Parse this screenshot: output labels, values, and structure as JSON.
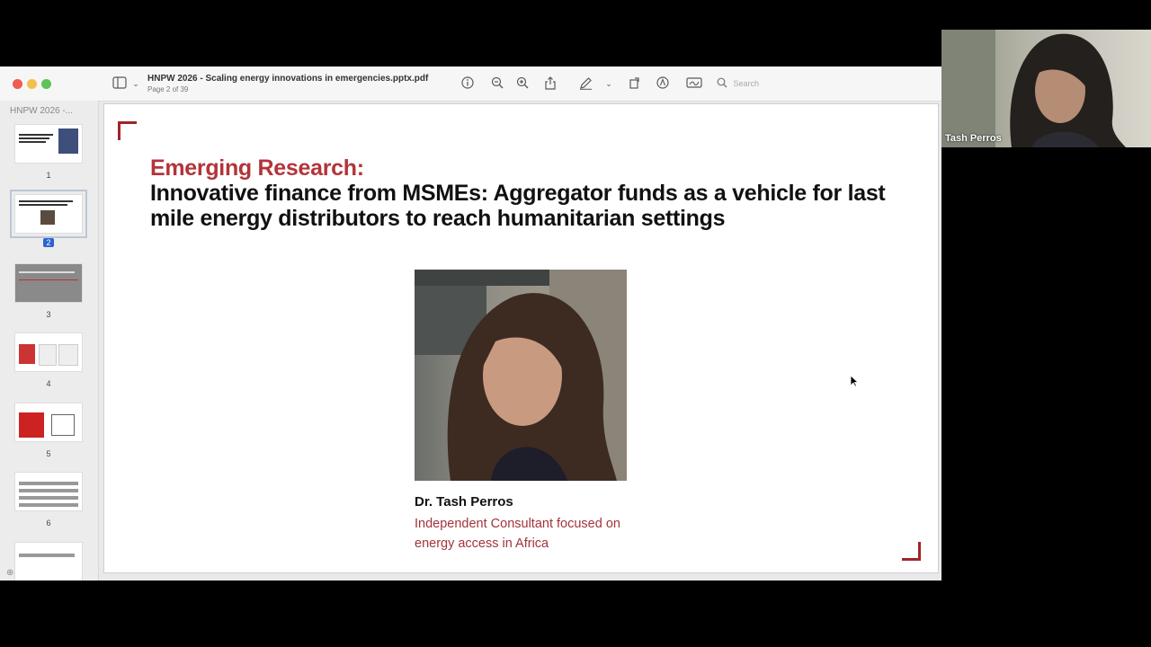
{
  "window": {
    "title": "HNPW 2026 - Scaling energy innovations in emergencies.pptx.pdf",
    "page_indicator": "Page 2 of 39",
    "search_placeholder": "Search"
  },
  "sidebar": {
    "title": "HNPW 2026 -...",
    "thumbnails": [
      {
        "label": "1",
        "selected": false
      },
      {
        "label": "2",
        "selected": true
      },
      {
        "label": "3",
        "selected": false
      },
      {
        "label": "4",
        "selected": false
      },
      {
        "label": "5",
        "selected": false
      },
      {
        "label": "6",
        "selected": false
      }
    ]
  },
  "slide": {
    "kicker": "Emerging Research:",
    "title": "Innovative finance from MSMEs: Aggregator funds as a vehicle for last mile energy distributors to reach humanitarian settings",
    "speaker_name": "Dr. Tash Perros",
    "speaker_role": "Independent Consultant focused on energy access in Africa",
    "accent_color": "#a3232a"
  },
  "webcam": {
    "participant_name": "Tash Perros"
  },
  "icons": [
    "sidebar-toggle-icon",
    "info-icon",
    "zoom-out-icon",
    "zoom-in-icon",
    "share-icon",
    "markup-pen-icon",
    "rotate-icon",
    "annotate-icon",
    "signature-icon",
    "search-icon"
  ]
}
